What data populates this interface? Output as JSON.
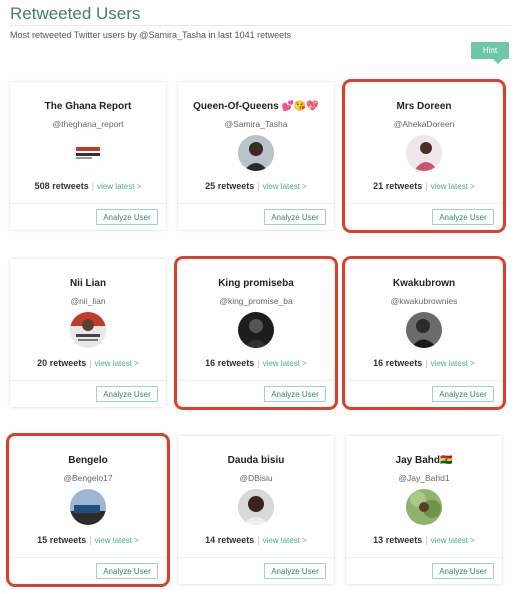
{
  "header": {
    "title": "Retweeted Users",
    "subtitle": "Most retweeted Twitter users by @Samira_Tasha in last 1041 retweets",
    "hint_label": "Hint"
  },
  "card_labels": {
    "retweets_suffix": "retweets",
    "separator": "|",
    "view_latest": "view latest >",
    "analyze": "Analyze User"
  },
  "colors": {
    "accent": "#4cae8a",
    "title": "#4a7c6f",
    "highlight": "#d9402e"
  },
  "users": [
    {
      "name": "The Ghana Report",
      "handle": "@theghana_report",
      "retweets": "508",
      "avatar": "ghana-report-logo",
      "highlighted": false
    },
    {
      "name": "Queen-Of-Queens 💕😘💖",
      "handle": "@Samira_Tasha",
      "retweets": "25",
      "avatar": "person-photo",
      "highlighted": false
    },
    {
      "name": "Mrs Doreen",
      "handle": "@AhekaDoreen",
      "retweets": "21",
      "avatar": "person-photo",
      "highlighted": true
    },
    {
      "name": "Nii Lian",
      "handle": "@nii_lian",
      "retweets": "20",
      "avatar": "person-photo",
      "highlighted": false
    },
    {
      "name": "King promiseba",
      "handle": "@king_promise_ba",
      "retweets": "16",
      "avatar": "person-photo",
      "highlighted": true
    },
    {
      "name": "Kwakubrown",
      "handle": "@kwakubrownies",
      "retweets": "16",
      "avatar": "person-photo",
      "highlighted": true
    },
    {
      "name": "Bengelo",
      "handle": "@Bengelo17",
      "retweets": "15",
      "avatar": "person-photo",
      "highlighted": true
    },
    {
      "name": "Dauda bisiu",
      "handle": "@DBisiu",
      "retweets": "14",
      "avatar": "person-photo",
      "highlighted": false
    },
    {
      "name": "Jay Bahd🇬🇭",
      "handle": "@Jay_Bahd1",
      "retweets": "13",
      "avatar": "person-photo",
      "highlighted": false
    }
  ]
}
